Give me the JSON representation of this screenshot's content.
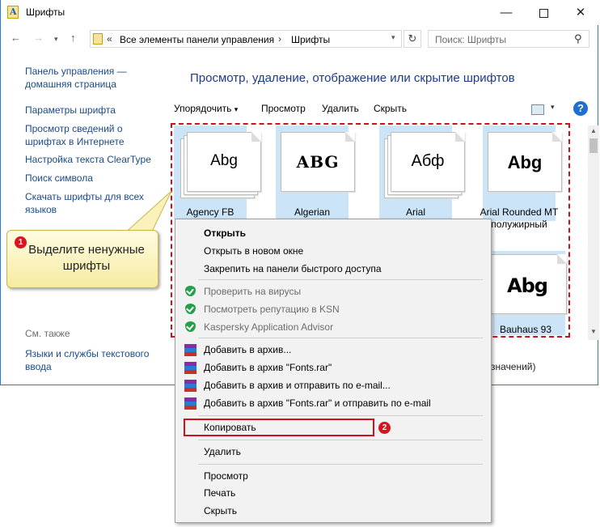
{
  "window": {
    "title": "Шрифты",
    "controls": {
      "minimize": "—",
      "maximize": "",
      "close": "✕"
    }
  },
  "nav": {
    "back": "←",
    "forward": "→",
    "history": "▾",
    "up": "↑",
    "address": {
      "chevrons": "«",
      "part1": "Все элементы панели управления",
      "arrow": "›",
      "part2": "Шрифты",
      "dropdown": "▾"
    },
    "refresh": "↻",
    "search_placeholder": "Поиск: Шрифты"
  },
  "sidebar": {
    "links": [
      "Панель управления — домашняя страница",
      "Параметры шрифта",
      "Просмотр сведений о шрифтах в Интернете",
      "Настройка текста ClearType",
      "Поиск символа",
      "Скачать шрифты для всех языков"
    ],
    "see_also": "См. также",
    "see_also_link": "Языки и службы текстового ввода"
  },
  "main": {
    "heading": "Просмотр, удаление, отображение или скрытие шрифтов",
    "toolbar": {
      "organize": "Упорядочить",
      "organize_dd": "▾",
      "view": "Просмотр",
      "delete": "Удалить",
      "hide": "Скрыть",
      "view_dd": "▾",
      "help": "?"
    },
    "fonts": [
      {
        "name": "Agency FB",
        "sample": "Abg",
        "selected": true
      },
      {
        "name": "Algerian",
        "sample": "ABG",
        "selected": true
      },
      {
        "name": "Arial",
        "sample": "Абф",
        "selected": true
      },
      {
        "name": "Arial Rounded MT полужирный",
        "sample": "Abg",
        "selected": true
      },
      {
        "name": "Bauhaus 93",
        "sample": "Abg",
        "selected": true
      }
    ],
    "status_fragment": "значений)"
  },
  "callout": {
    "number": "1",
    "text": "Выделите ненужные шрифты"
  },
  "context_menu": {
    "group1": [
      "Открыть",
      "Открыть в новом окне",
      "Закрепить на панели быстрого доступа"
    ],
    "group2": [
      "Проверить на вирусы",
      "Посмотреть репутацию в KSN",
      "Kaspersky Application Advisor"
    ],
    "group3": [
      "Добавить в архив...",
      "Добавить в архив \"Fonts.rar\"",
      "Добавить в архив и отправить по e-mail...",
      "Добавить в архив \"Fonts.rar\" и отправить по e-mail"
    ],
    "copy": "Копировать",
    "copy_badge": "2",
    "delete": "Удалить",
    "group6": [
      "Просмотр",
      "Печать",
      "Скрыть"
    ]
  },
  "colors": {
    "accent": "#1e6fd0",
    "highlight": "#d0101c",
    "selection": "#cce4f7",
    "link": "#1a4a8a"
  }
}
